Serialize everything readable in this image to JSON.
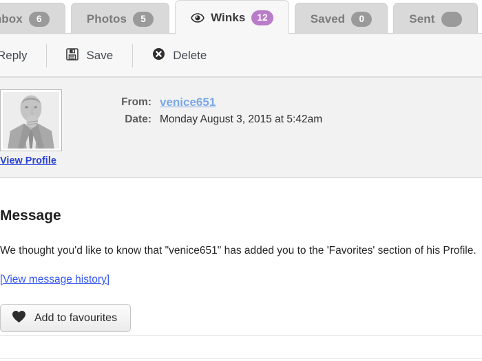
{
  "tabs": [
    {
      "label": "Inbox",
      "icon": "inbox-icon",
      "count": "6",
      "active": false,
      "accent": false
    },
    {
      "label": "Photos",
      "icon": null,
      "count": "5",
      "active": false,
      "accent": false
    },
    {
      "label": "Winks",
      "icon": "eye-icon",
      "count": "12",
      "active": true,
      "accent": true
    },
    {
      "label": "Saved",
      "icon": null,
      "count": "0",
      "active": false,
      "accent": false
    },
    {
      "label": "Sent",
      "icon": null,
      "count": "",
      "active": false,
      "accent": false
    }
  ],
  "toolbar": {
    "reply_label": "Reply",
    "save_label": "Save",
    "delete_label": "Delete"
  },
  "message_header": {
    "profile_link_label": "View Profile",
    "from_key": "From:",
    "from_value": "venice651",
    "date_key": "Date:",
    "date_value": "Monday August 3, 2015 at 5:42am"
  },
  "message_body": {
    "title": "Message",
    "text": "We thought you'd like to know that \"venice651\" has added you to the 'Favorites' section of his Profile.",
    "history_link": "[View message history]",
    "favourite_button": "Add to favourites"
  },
  "colors": {
    "accent_badge": "#b87cc8",
    "badge_gray": "#9a9a9a",
    "link_blue": "#3355ee",
    "sender_blue": "#7ba7e6",
    "profile_link_blue": "#2b44d6",
    "tab_inactive": "#d9d9d9",
    "tab_active": "#f7f7f7",
    "panel_gray": "#f2f2f2"
  }
}
